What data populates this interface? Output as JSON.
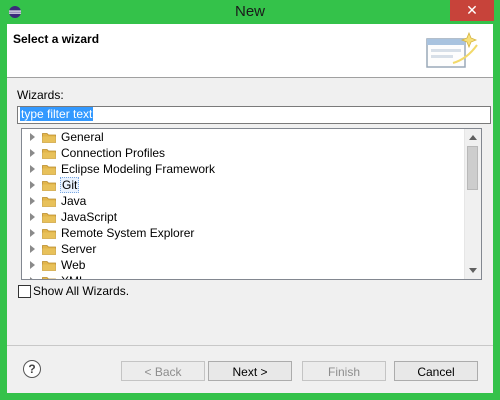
{
  "window": {
    "title": "New",
    "close_symbol": "✕",
    "app_icon": "eclipse-icon"
  },
  "header": {
    "title": "Select a wizard",
    "banner_icon": "wizard-banner-icon"
  },
  "filter": {
    "label": "Wizards:",
    "value": "type filter text"
  },
  "tree": {
    "items": [
      {
        "label": "General"
      },
      {
        "label": "Connection Profiles"
      },
      {
        "label": "Eclipse Modeling Framework"
      },
      {
        "label": "Git"
      },
      {
        "label": "Java"
      },
      {
        "label": "JavaScript"
      },
      {
        "label": "Remote System Explorer"
      },
      {
        "label": "Server"
      },
      {
        "label": "Web"
      },
      {
        "label": "XML"
      }
    ],
    "focused_index": 3
  },
  "show_all": {
    "label": "Show All Wizards.",
    "checked": false
  },
  "buttons": {
    "help": "?",
    "back": "< Back",
    "next": "Next >",
    "finish": "Finish",
    "cancel": "Cancel"
  },
  "colors": {
    "window_frame": "#34c24a",
    "close_button": "#c7433a",
    "selection": "#3399ff",
    "folder": "#e8c15a"
  }
}
